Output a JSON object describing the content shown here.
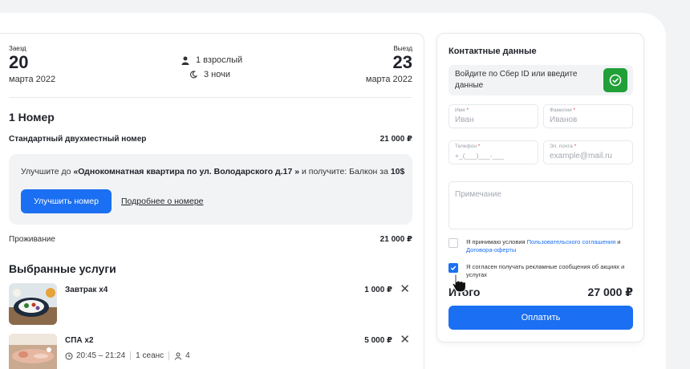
{
  "booking": {
    "checkin": {
      "label": "Заезд",
      "day": "20",
      "month": "марта 2022"
    },
    "checkout": {
      "label": "Выезд",
      "day": "23",
      "month": "марта 2022"
    },
    "guests": "1 взрослый",
    "nights": "3 ночи",
    "rooms_title": "1 Номер",
    "room": {
      "name": "Стандартный двухместный номер",
      "price": "21 000 ₽"
    },
    "upgrade": {
      "prefix": "Улучшите до ",
      "target": "«Однокомнатная квартира по ул. Володарского д.17 »",
      "middle": " и получите: Балкон за ",
      "price": "10$",
      "button": "Улучшить номер",
      "more_link": "Подробнее о номере"
    },
    "stay": {
      "label": "Проживание",
      "price": "21 000 ₽"
    },
    "services_title": "Выбранные услуги",
    "services": [
      {
        "name": "Завтрак x4",
        "price": "1 000 ₽"
      },
      {
        "name": "СПА x2",
        "price": "5 000 ₽",
        "time": "20:45 – 21:24",
        "sessions": "1 сеанс",
        "people": "4"
      }
    ]
  },
  "contact": {
    "title": "Контактные данные",
    "sber_text": "Войдите по Сбер ID или введите данные",
    "fields": {
      "first_name": {
        "label": "Имя",
        "value": "Иван"
      },
      "last_name": {
        "label": "Фамилия",
        "value": "Иванов"
      },
      "phone": {
        "label": "Телефон",
        "value": "+_(___)___-___"
      },
      "email": {
        "label": "Эл. почта",
        "value": "example@mail.ru"
      },
      "note": {
        "placeholder": "Примечание"
      }
    },
    "terms": {
      "prefix": "Я принимаю условия ",
      "link1": "Пользовательского соглашения",
      "and": " и ",
      "link2": "Договора-оферты"
    },
    "ads": "Я согласен получать рекламные сообщения об акциях и услугах",
    "total_label": "Итого",
    "total_value": "27 000 ₽",
    "pay_button": "Оплатить"
  },
  "colors": {
    "accent": "#1b6ff2",
    "sber_green": "#21a038",
    "panel_bg": "#f2f3f5"
  }
}
